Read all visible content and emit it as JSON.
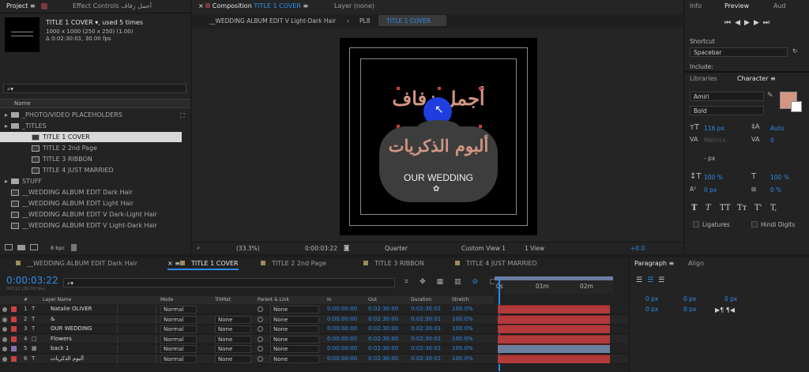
{
  "project_panel": {
    "tab_project": "Project",
    "tab_effect_controls": "Effect Controls أجمل زفاف",
    "comp_name": "TITLE 1 COVER",
    "comp_used": ", used 5 times",
    "comp_size": "1000 x 1000  (250 x 250) (1.00)",
    "comp_duration": "Δ 0:02:30:01, 30.00 fps",
    "name_header": "Name",
    "bpc": "8 bpc",
    "items": [
      {
        "label": "_PHOTO/VIDEO PLACEHOLDERS",
        "kind": "folder",
        "indent": 0
      },
      {
        "label": "_TITLES",
        "kind": "folder",
        "indent": 0
      },
      {
        "label": "TITLE 1 COVER",
        "kind": "comp",
        "indent": 1,
        "selected": true
      },
      {
        "label": "TITLE 2 2nd Page",
        "kind": "comp",
        "indent": 1
      },
      {
        "label": "TITLE 3 RIBBON",
        "kind": "comp",
        "indent": 1
      },
      {
        "label": "TITLE 4 JUST MARRIED",
        "kind": "comp",
        "indent": 1
      },
      {
        "label": "STUFF",
        "kind": "folder",
        "indent": 0
      },
      {
        "label": "__WEDDING ALBUM EDIT Dark Hair",
        "kind": "comp",
        "indent": 0
      },
      {
        "label": "__WEDDING ALBUM EDIT Light Hair",
        "kind": "comp",
        "indent": 0
      },
      {
        "label": "__WEDDING ALBUM EDIT V Dark-Light Hair",
        "kind": "comp",
        "indent": 0
      },
      {
        "label": "__WEDDING ALBUM EDIT V Light-Dark Hair",
        "kind": "comp",
        "indent": 0
      }
    ]
  },
  "composition_panel": {
    "tab_prefix": "Composition",
    "tab_comp": "TITLE 1 COVER",
    "tab_layer": "Layer (none)",
    "breadcrumbs": [
      "__WEDDING ALBUM EDIT V Light-Dark Hair",
      "PL8",
      "TITLE 1 COVER"
    ],
    "arabic_title": "أجمل زفاف",
    "arabic_subtitle": "ألبوم الذكريات",
    "english_title": "OUR WEDDING",
    "zoom": "(33.3%)",
    "timecode": "0:00:03:22",
    "resolution": "Quarter",
    "view": "Custom View 1",
    "views_count": "1 View",
    "exposure": "+0.0"
  },
  "right_panels": {
    "tab_info": "Info",
    "tab_preview": "Preview",
    "tab_audio": "Aud",
    "shortcut_label": "Shortcut",
    "shortcut_value": "Spacebar",
    "include_label": "Include:",
    "tab_libraries": "Libraries",
    "tab_character": "Character",
    "font_name": "Amiri",
    "font_style": "Bold",
    "font_size": "116 px",
    "leading": "Auto",
    "kerning": "Metrics",
    "tracking": "0",
    "stroke_unit": "- px",
    "vert_scale": "100 %",
    "horiz_scale": "100 %",
    "baseline": "0 px",
    "tsume": "0 %",
    "style_buttons": [
      "T",
      "T",
      "TT",
      "Tт",
      "T'",
      "T,"
    ],
    "ligatures": "Ligatures",
    "hindi_digits": "Hindi Digits",
    "fill_color": "#d39683",
    "tab_paragraph": "Paragraph",
    "tab_align": "Align",
    "indent_values": [
      "0 px",
      "0 px",
      "0 px",
      "0 px",
      "0 px"
    ]
  },
  "timeline": {
    "tabs": [
      "__WEDDING ALBUM EDIT Dark Hair",
      "TITLE 1 COVER",
      "TITLE 2 2nd Page",
      "TITLE 3 RIBBON",
      "TITLE 4 JUST MARRIED"
    ],
    "active_tab": 1,
    "current_time": "0:00:03:22",
    "frame_info": "00112 (30.00 fps)",
    "headers": {
      "num": "#",
      "layer_name": "Layer Name",
      "mode": "Mode",
      "trkmat": "TrkMat",
      "parent": "Parent & Link",
      "in": "In",
      "out": "Out",
      "duration": "Duration",
      "stretch": "Stretch"
    },
    "ruler": [
      "0s",
      "01m",
      "02m"
    ],
    "layers": [
      {
        "num": "1",
        "type": "T",
        "name": "Natalie OLIVER",
        "mode": "Normal",
        "trkmat": "",
        "parent": "None",
        "in": "0:00:00:00",
        "out": "0:02:30:00",
        "duration": "0:02:30:01",
        "stretch": "100.0%"
      },
      {
        "num": "2",
        "type": "T",
        "name": "&",
        "mode": "Normal",
        "trkmat": "None",
        "parent": "None",
        "in": "0:00:00:00",
        "out": "0:02:30:00",
        "duration": "0:02:30:01",
        "stretch": "100.0%"
      },
      {
        "num": "3",
        "type": "T",
        "name": "OUR WEDDING",
        "mode": "Normal",
        "trkmat": "None",
        "parent": "None",
        "in": "0:00:00:00",
        "out": "0:02:30:00",
        "duration": "0:02:30:01",
        "stretch": "100.0%"
      },
      {
        "num": "4",
        "type": "□",
        "name": "Flowers",
        "mode": "Normal",
        "trkmat": "None",
        "parent": "None",
        "in": "0:00:00:00",
        "out": "0:02:30:00",
        "duration": "0:02:30:01",
        "stretch": "100.0%"
      },
      {
        "num": "5",
        "type": "▦",
        "name": "back 1",
        "mode": "Normal",
        "trkmat": "None",
        "parent": "None",
        "in": "0:00:00:00",
        "out": "0:02:30:00",
        "duration": "0:02:30:01",
        "stretch": "100.0%"
      },
      {
        "num": "6",
        "type": "T",
        "name": "ألبوم الذكريات",
        "mode": "Normal",
        "trkmat": "None",
        "parent": "None",
        "in": "0:00:00:00",
        "out": "0:02:30:00",
        "duration": "0:02:30:01",
        "stretch": "100.0%"
      }
    ]
  },
  "colors": {
    "accent_blue": "#2d8ceb",
    "layer_bar": "#b23a3a",
    "selected_bar": "#6a7fa0",
    "label_red": "#c94040"
  }
}
